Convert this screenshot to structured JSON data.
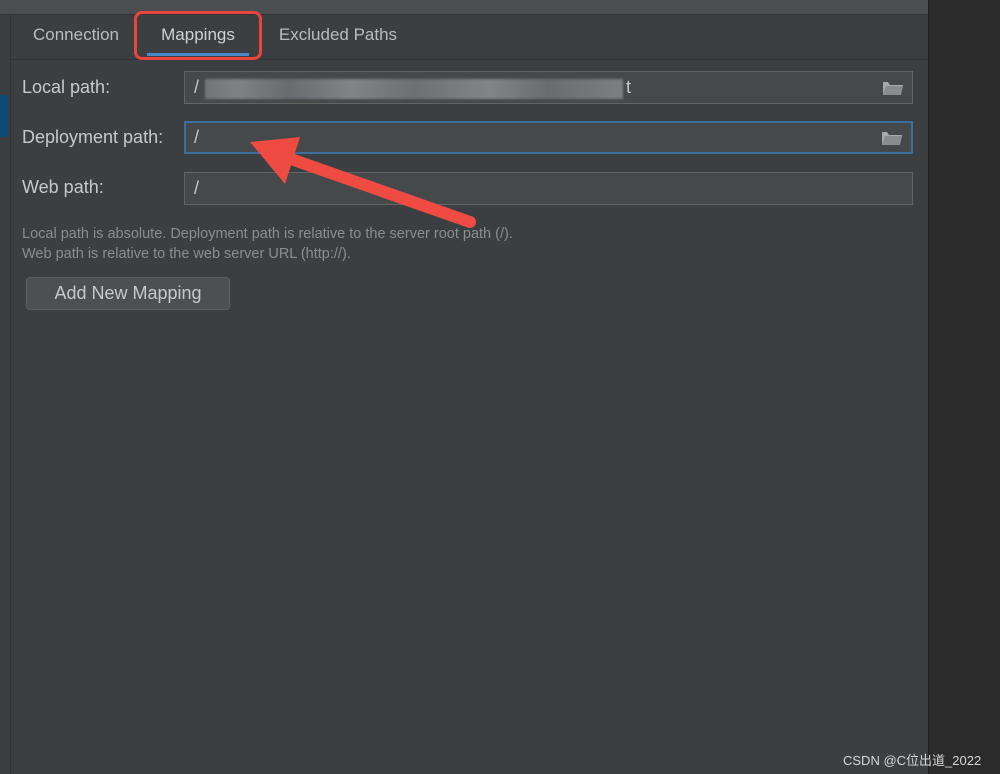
{
  "tabs": {
    "connection": "Connection",
    "mappings": "Mappings",
    "excluded": "Excluded Paths"
  },
  "local_path": {
    "label": "Local path:",
    "value_prefix": "/",
    "value_suffix": "t",
    "icon": "folder-icon"
  },
  "deployment_path": {
    "label": "Deployment path:",
    "value": "/",
    "icon": "folder-icon"
  },
  "web_path": {
    "label": "Web path:",
    "value": "/"
  },
  "hints": {
    "line1": "Local path is absolute. Deployment path is relative to the server root path (/).",
    "line2": "Web path is relative to the web server URL (http://)."
  },
  "add_button": "Add New Mapping",
  "watermark": "CSDN @C位出道_2022",
  "colors": {
    "background": "#3c3f41",
    "highlight_box": "#e8453c",
    "annotation_arrow": "#ef4b43",
    "focus_border": "#3d6f9e",
    "tab_underline": "#4a88c7"
  }
}
